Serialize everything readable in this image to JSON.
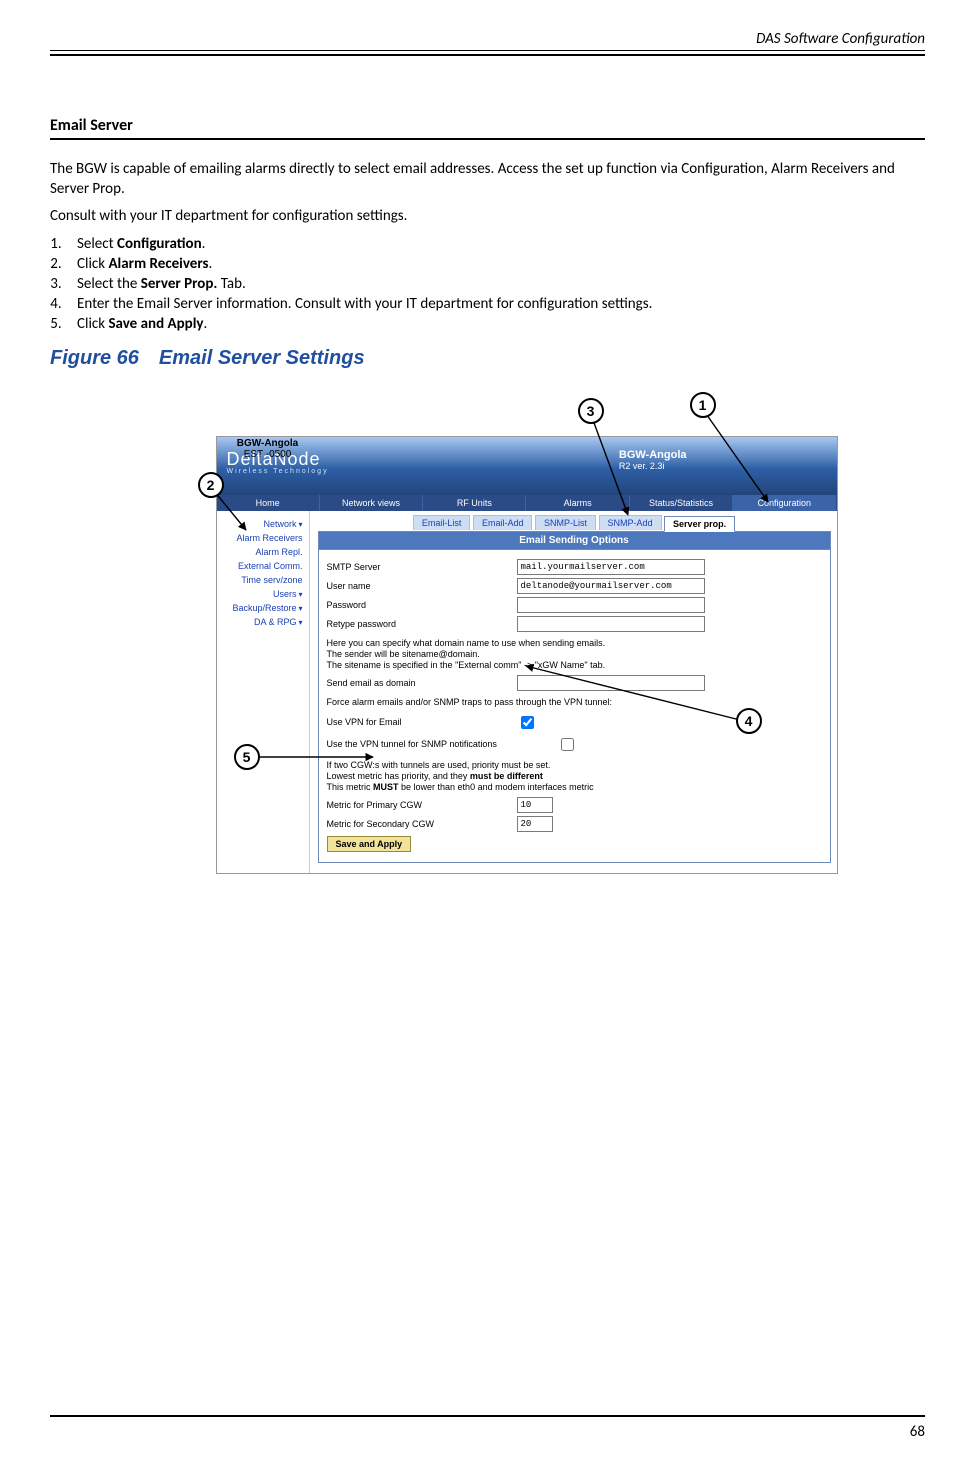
{
  "running_head": "DAS Software Configuration",
  "section_title": "Email Server",
  "intro_para": "The BGW is capable of emailing alarms directly to select email addresses. Access the set up function via Configuration, Alarm Receivers and Server Prop.",
  "consult_para": "Consult with your IT department for configuration settings.",
  "steps": [
    {
      "pre": "Select ",
      "bold": "Configuration",
      "post": "."
    },
    {
      "pre": "Click ",
      "bold": "Alarm Receivers",
      "post": "."
    },
    {
      "pre": "Select the ",
      "bold": "Server Prop.",
      "post": " Tab."
    },
    {
      "pre": "Enter the Email Server information. Consult with your IT department for configuration settings.",
      "bold": "",
      "post": ""
    },
    {
      "pre": "Click ",
      "bold": "Save and Apply",
      "post": "."
    }
  ],
  "figure_caption": "Figure 66 Email Server Settings",
  "callouts": {
    "c1": "1",
    "c2": "2",
    "c3": "3",
    "c4": "4",
    "c5": "5"
  },
  "gw": {
    "name": "BGW-Angola",
    "tz": "EST -0500"
  },
  "banner": {
    "brand": "DeltaNode",
    "brand_sub": "Wireless   Technology",
    "bgw_name": "BGW-Angola",
    "bgw_ver": "R2 ver. 2.3i"
  },
  "nav1": [
    "Home",
    "Network views",
    "RF Units",
    "Alarms",
    "Status/Statistics",
    "Configuration"
  ],
  "sidebar": [
    "Network",
    "Alarm Receivers",
    "Alarm Repl.",
    "External Comm.",
    "Time serv/zone",
    "Users",
    "Backup/Restore",
    "DA & RPG"
  ],
  "sidebar_dropdowns": [
    0,
    5,
    6,
    7
  ],
  "tabs2": [
    "Email-List",
    "Email-Add",
    "SNMP-List",
    "SNMP-Add",
    "Server prop."
  ],
  "panel_title": "Email Sending Options",
  "fields": {
    "smtp_label": "SMTP Server",
    "smtp_value": "mail.yourmailserver.com",
    "user_label": "User name",
    "user_value": "deltanode@yourmailserver.com",
    "pass_label": "Password",
    "pass_value": "",
    "rpass_label": "Retype password",
    "rpass_value": "",
    "domain_note": "Here you can specify what domain name to use when sending emails.\nThe sender will be sitename@domain.\nThe sitename is specified in the \"External comm\" -> \"xGW Name\" tab.",
    "domain_label": "Send email as domain",
    "domain_value": "",
    "vpn_note": "Force alarm emails and/or SNMP traps to pass through the VPN tunnel:",
    "vpn_email_label": "Use VPN for Email",
    "vpn_email_checked": true,
    "vpn_snmp_label": "Use the VPN tunnel for SNMP notifications",
    "vpn_snmp_checked": false,
    "metric_note_l1": "If two CGW:s with tunnels are used, priority must be set.",
    "metric_note_l2a": "Lowest metric has priority, and they ",
    "metric_note_l2b": "must be different",
    "metric_note_l3a": "This metric ",
    "metric_note_l3b": "MUST",
    "metric_note_l3c": " be lower than eth0 and modem interfaces metric",
    "metric1_label": "Metric for Primary CGW",
    "metric1_value": "10",
    "metric2_label": "Metric for Secondary CGW",
    "metric2_value": "20",
    "save_label": "Save and Apply"
  },
  "page_number": "68"
}
